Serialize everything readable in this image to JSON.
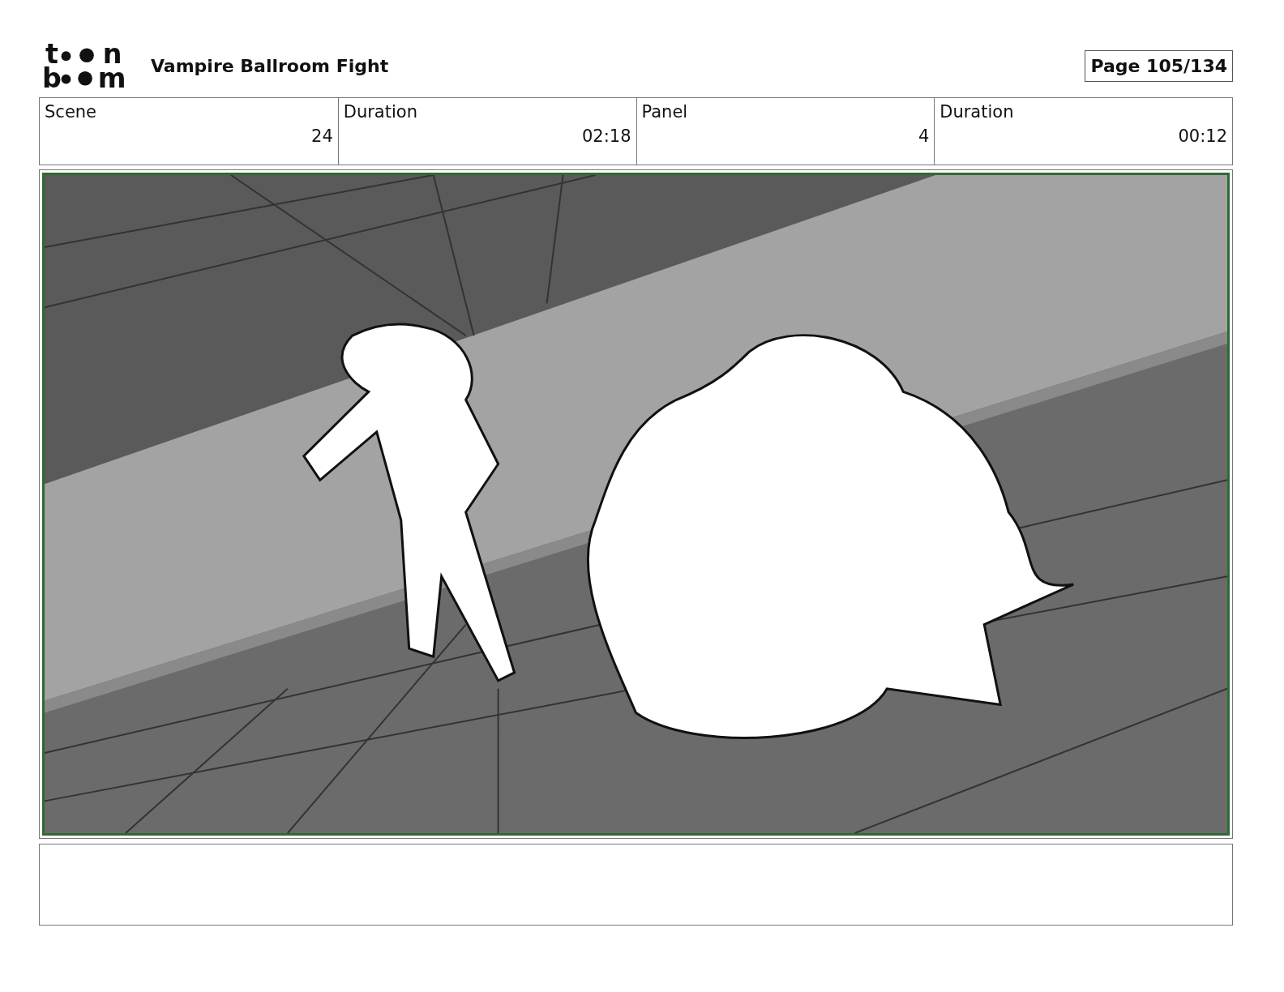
{
  "logo": {
    "letters": [
      "t",
      "n",
      "b",
      "m"
    ]
  },
  "title": "Vampire Ballroom Fight",
  "page": "Page 105/134",
  "info": {
    "columns": [
      "Scene",
      "Duration",
      "Panel",
      "Duration"
    ],
    "values": [
      "24",
      "02:18",
      "4",
      "00:12"
    ]
  }
}
